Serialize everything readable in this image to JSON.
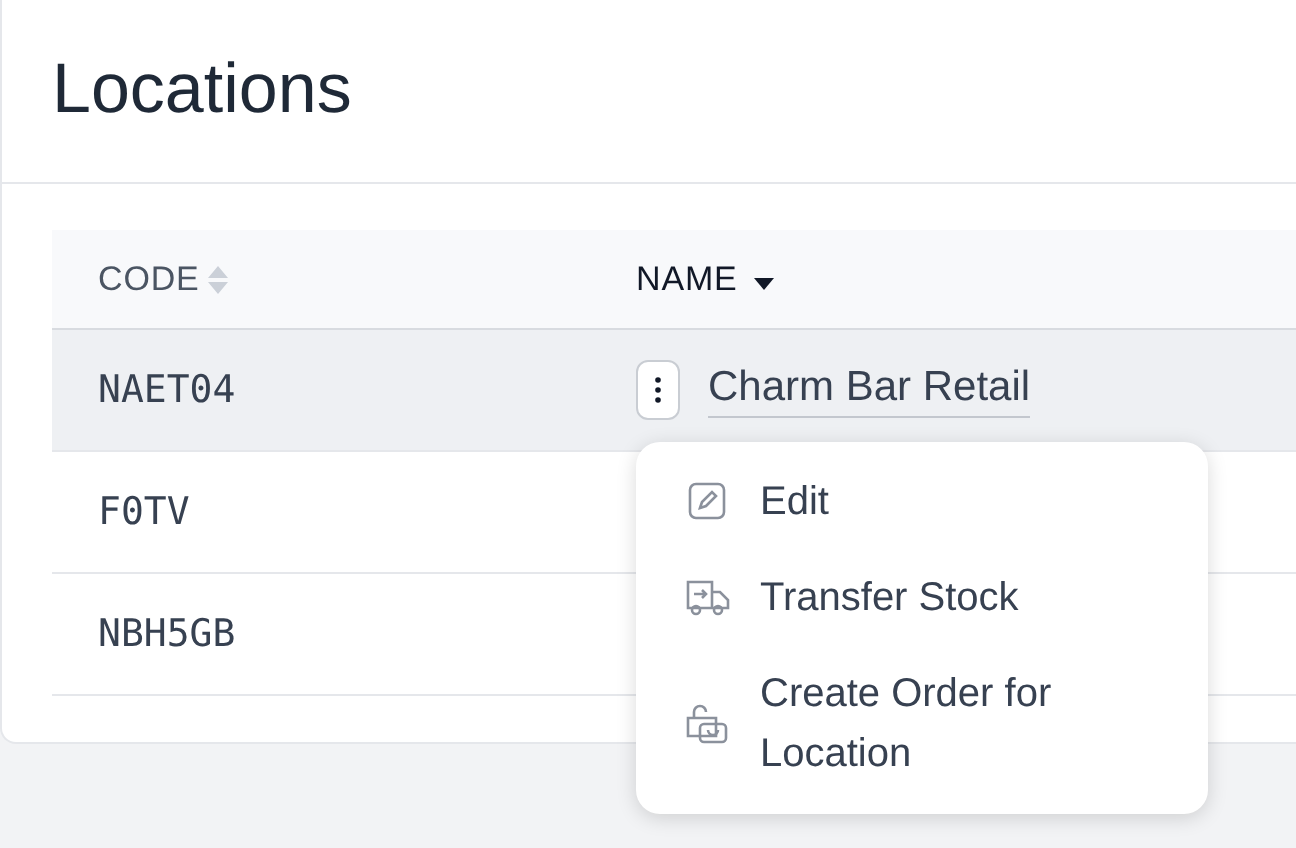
{
  "title": "Locations",
  "table": {
    "columns": [
      {
        "label": "CODE",
        "kind": "unsorted"
      },
      {
        "label": "NAME",
        "kind": "sorted-desc"
      }
    ],
    "rows": [
      {
        "code": "NAET04",
        "name": "Charm Bar Retail",
        "selected": true
      },
      {
        "code": "F0TV",
        "selected": false
      },
      {
        "code": "NBH5GB",
        "selected": false
      }
    ]
  },
  "menu": {
    "items": [
      {
        "label": "Edit",
        "kind": "edit"
      },
      {
        "label": "Transfer Stock",
        "kind": "truck"
      },
      {
        "label": "Create Order for Location",
        "kind": "bag"
      }
    ]
  }
}
